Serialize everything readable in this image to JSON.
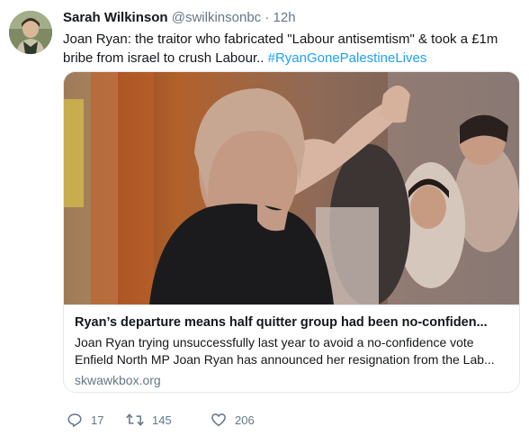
{
  "tweet": {
    "author": {
      "name": "Sarah Wilkinson",
      "handle": "@swilkinsonbc",
      "separator": "·",
      "time": "12h"
    },
    "text_main": "Joan Ryan: the traitor who fabricated \"Labour antisemtism\" & took a £1m bribe from israel to crush Labour.. ",
    "hashtag": "#RyanGonePalestineLives",
    "card": {
      "title": "Ryan’s departure means half quitter group had been no-confiden...",
      "description_line1": "Joan Ryan trying unsuccessfully last year to avoid a no-confidence vote",
      "description_line2": "Enfield North MP Joan Ryan has announced her resignation from the Lab...",
      "domain": "skwawkbox.org"
    },
    "actions": {
      "replies": "17",
      "retweets": "145",
      "likes": "206"
    },
    "icons": [
      "reply-icon",
      "retweet-icon",
      "like-icon"
    ],
    "colors": {
      "link": "#1da1f2",
      "secondary": "#657786",
      "border": "#e1e8ed"
    }
  }
}
